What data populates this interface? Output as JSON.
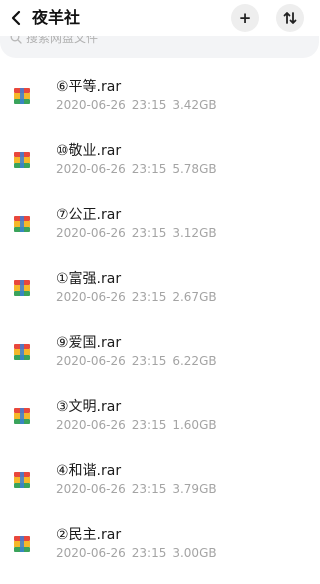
{
  "header": {
    "title": "夜羊社",
    "add_label": "+",
    "sort_label": "⇅"
  },
  "search": {
    "placeholder": "搜索网盘文件"
  },
  "files": [
    {
      "name": "⑥平等.rar",
      "date": "2020-06-26",
      "time": "23:15",
      "size": "3.42GB"
    },
    {
      "name": "⑩敬业.rar",
      "date": "2020-06-26",
      "time": "23:15",
      "size": "5.78GB"
    },
    {
      "name": "⑦公正.rar",
      "date": "2020-06-26",
      "time": "23:15",
      "size": "3.12GB"
    },
    {
      "name": "①富强.rar",
      "date": "2020-06-26",
      "time": "23:15",
      "size": "2.67GB"
    },
    {
      "name": "⑨爱国.rar",
      "date": "2020-06-26",
      "time": "23:15",
      "size": "6.22GB"
    },
    {
      "name": "③文明.rar",
      "date": "2020-06-26",
      "time": "23:15",
      "size": "1.60GB"
    },
    {
      "name": "④和谐.rar",
      "date": "2020-06-26",
      "time": "23:15",
      "size": "3.79GB"
    },
    {
      "name": "②民主.rar",
      "date": "2020-06-26",
      "time": "23:15",
      "size": "3.00GB"
    }
  ],
  "colors": {
    "icon_top": "#e8473c",
    "icon_mid": "#f5b82a",
    "icon_bottom": "#3aa35b",
    "icon_band": "#3b7fd6"
  }
}
